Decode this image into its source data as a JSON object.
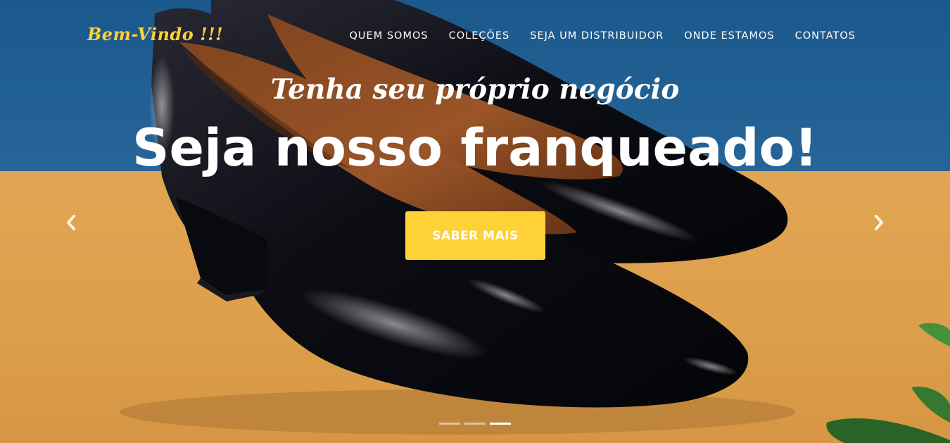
{
  "brand": {
    "label": "Bem-Vindo !!!",
    "color": "#fed136"
  },
  "nav": {
    "items": [
      {
        "label": "QUEM SOMOS"
      },
      {
        "label": "COLEÇÕES"
      },
      {
        "label": "SEJA UM DISTRIBUIDOR"
      },
      {
        "label": "ONDE ESTAMOS"
      },
      {
        "label": "CONTATOS"
      }
    ]
  },
  "hero": {
    "subtitle": "Tenha seu próprio negócio",
    "headline": "Seja nosso franqueado!",
    "cta_label": "SABER MAIS",
    "cta_color": "#fed136"
  },
  "carousel": {
    "prev_icon": "chevron-left-icon",
    "next_icon": "chevron-right-icon",
    "slide_count": 3,
    "active_slide": 3
  },
  "colors": {
    "wall": "#23649b",
    "table": "#eeab55"
  }
}
